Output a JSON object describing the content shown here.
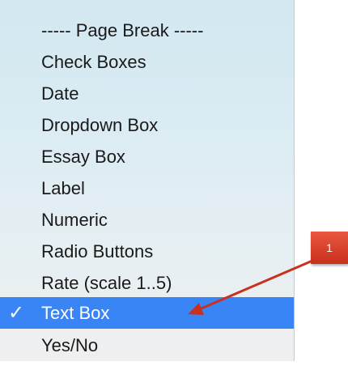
{
  "menu": {
    "items": [
      {
        "label": "----- Page Break -----",
        "selected": false
      },
      {
        "label": "Check Boxes",
        "selected": false
      },
      {
        "label": "Date",
        "selected": false
      },
      {
        "label": "Dropdown Box",
        "selected": false
      },
      {
        "label": "Essay Box",
        "selected": false
      },
      {
        "label": "Label",
        "selected": false
      },
      {
        "label": "Numeric",
        "selected": false
      },
      {
        "label": "Radio Buttons",
        "selected": false
      },
      {
        "label": "Rate (scale 1..5)",
        "selected": false
      },
      {
        "label": "Text Box",
        "selected": true
      },
      {
        "label": "Yes/No",
        "selected": false
      }
    ],
    "checkmark": "✓",
    "selected_color": "#3a85f6"
  },
  "callout": {
    "number": "1",
    "color": "#d2392a"
  }
}
